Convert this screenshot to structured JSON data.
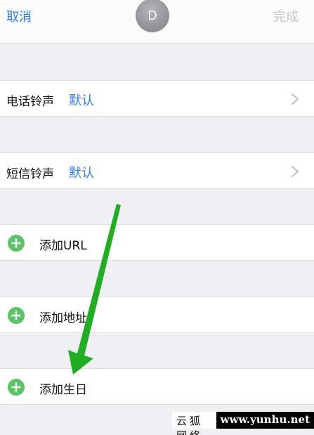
{
  "navbar": {
    "cancel_label": "取消",
    "done_label": "完成",
    "avatar_initial": "D"
  },
  "rows": {
    "phone_ringtone": {
      "label": "电话铃声",
      "value": "默认"
    },
    "sms_ringtone": {
      "label": "短信铃声",
      "value": "默认"
    },
    "add_url": {
      "label": "添加URL"
    },
    "add_address": {
      "label": "添加地址"
    },
    "add_birthday": {
      "label": "添加生日"
    }
  },
  "watermark": {
    "site_name": "云狐网络",
    "site_url": "www.yunhu.net"
  },
  "colors": {
    "accent": "#2f7cf6",
    "add_green": "#5ac467",
    "arrow_green": "#1fae1f",
    "background": "#efeff4"
  },
  "icons": [
    "chevron-right-icon",
    "add-circle-icon",
    "green-arrow-annotation"
  ]
}
